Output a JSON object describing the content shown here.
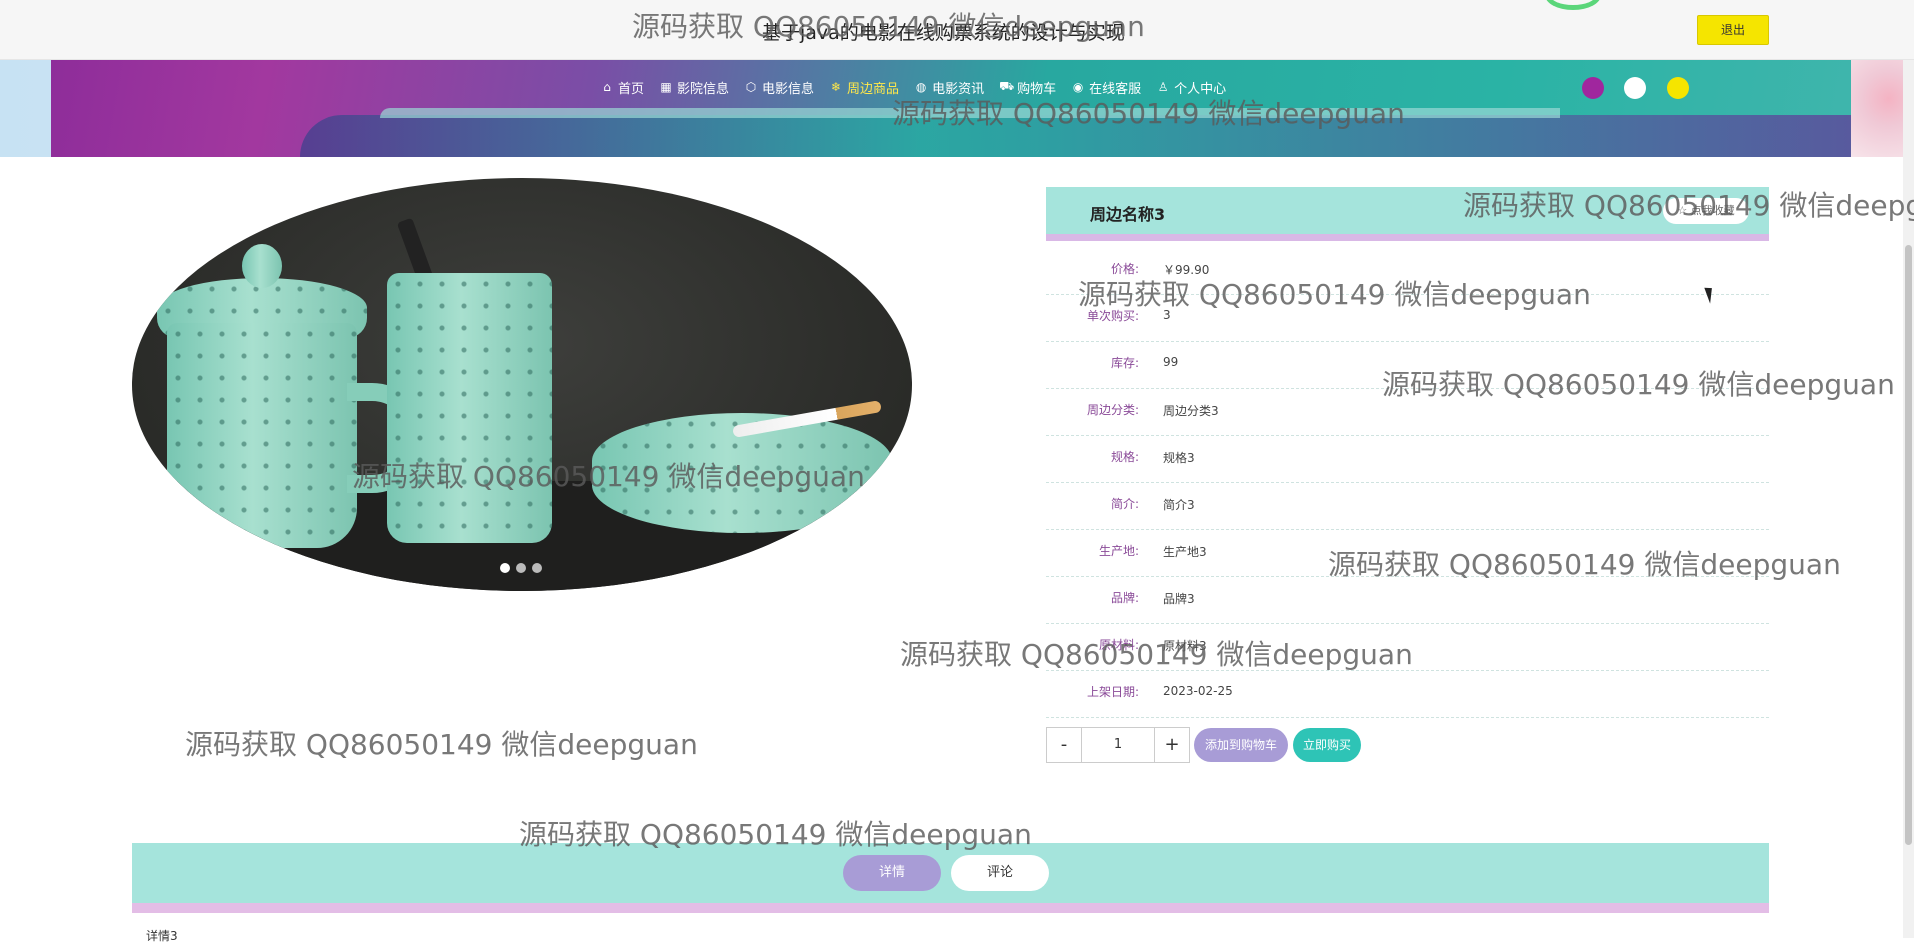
{
  "header": {
    "site_title": "基于java的电影在线购票系统的设计与实现",
    "logout_label": "退出"
  },
  "nav": {
    "items": [
      {
        "icon": "home-icon",
        "glyph": "⌂",
        "label": "首页"
      },
      {
        "icon": "cinema-icon",
        "glyph": "▦",
        "label": "影院信息"
      },
      {
        "icon": "cube-icon",
        "glyph": "⬡",
        "label": "电影信息"
      },
      {
        "icon": "snowflake-icon",
        "glyph": "❄",
        "label": "周边商品"
      },
      {
        "icon": "palette-icon",
        "glyph": "◍",
        "label": "电影资讯"
      },
      {
        "icon": "cart-icon",
        "glyph": "⛟",
        "label": "购物车"
      },
      {
        "icon": "support-icon",
        "glyph": "◉",
        "label": "在线客服"
      },
      {
        "icon": "user-icon",
        "glyph": "♙",
        "label": "个人中心"
      }
    ],
    "active_index": 3,
    "theme_colors": [
      "#a0269e",
      "#ffffff",
      "#f5e500"
    ]
  },
  "product": {
    "name": "周边名称3",
    "favorite_label": "☆ 点我收藏",
    "fields": [
      {
        "label": "价格:",
        "value": "￥99.90"
      },
      {
        "label": "单次购买:",
        "value": "3"
      },
      {
        "label": "库存:",
        "value": "99"
      },
      {
        "label": "周边分类:",
        "value": "周边分类3"
      },
      {
        "label": "规格:",
        "value": "规格3"
      },
      {
        "label": "简介:",
        "value": "简介3"
      },
      {
        "label": "生产地:",
        "value": "生产地3"
      },
      {
        "label": "品牌:",
        "value": "品牌3"
      },
      {
        "label": "原材料:",
        "value": "原材料3"
      },
      {
        "label": "上架日期:",
        "value": "2023-02-25"
      }
    ],
    "quantity": "1",
    "minus_label": "-",
    "plus_label": "+",
    "add_to_cart_label": "添加到购物车",
    "buy_now_label": "立即购买"
  },
  "gallery": {
    "slide_count": 3,
    "active_slide": 0
  },
  "tabs": {
    "items": [
      "详情",
      "评论"
    ],
    "active": 0,
    "content": "详情3"
  },
  "watermark": {
    "text": "源码获取 QQ86050149 微信deepguan"
  },
  "colors": {
    "accent_teal": "#2ec4b6",
    "accent_purple": "#a89cd6",
    "panel_teal": "#a5e4dc",
    "logout_yellow": "#f5e500"
  }
}
